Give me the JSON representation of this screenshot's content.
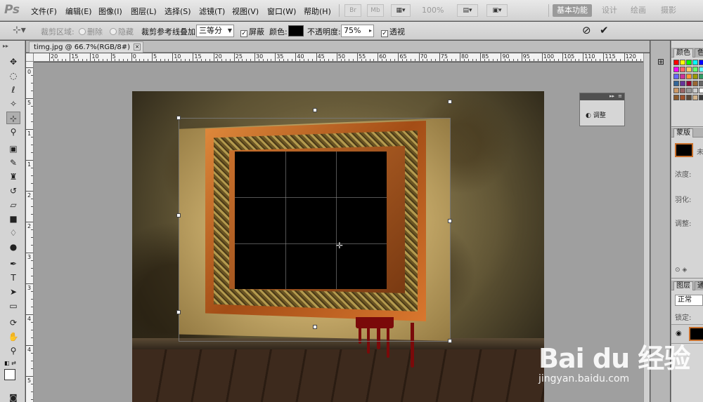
{
  "app": {
    "logo": "Ps",
    "menu": [
      "文件(F)",
      "编辑(E)",
      "图像(I)",
      "图层(L)",
      "选择(S)",
      "滤镜(T)",
      "视图(V)",
      "窗口(W)",
      "帮助(H)"
    ],
    "menubar_icons": [
      "Br",
      "Mb"
    ],
    "zoom": "100%",
    "workspaces": [
      "基本功能",
      "设计",
      "绘画",
      "摄影"
    ]
  },
  "options": {
    "crop_area_label": "裁剪区域:",
    "delete_label": "删除",
    "hide_label": "隐藏",
    "overlay_label": "裁剪参考线叠加:",
    "overlay_value": "三等分",
    "shield_label": "屏蔽",
    "shield_checked": true,
    "color_label": "颜色:",
    "shield_color": "#000000",
    "opacity_label": "不透明度:",
    "opacity_value": "75%",
    "perspective_label": "透视",
    "perspective_checked": true
  },
  "document": {
    "tab_title": "timg.jpg @ 66.7%(RGB/8#)",
    "ruler_top_labels": [
      "20",
      "15",
      "10",
      "5",
      "0",
      "5",
      "10",
      "15",
      "20",
      "25",
      "30",
      "35",
      "40",
      "45",
      "50",
      "55",
      "60",
      "65",
      "70",
      "75",
      "80",
      "85",
      "90",
      "95",
      "100",
      "105",
      "110",
      "115",
      "120"
    ],
    "ruler_left_labels": [
      "0",
      "5",
      "1",
      "1",
      "2",
      "2",
      "3",
      "3",
      "4",
      "4",
      "5"
    ]
  },
  "float_panel": {
    "button_label": "调整"
  },
  "panels": {
    "color_tab": "颜色",
    "color_tab2": "色",
    "masks_tab": "蒙版",
    "mask_label": "未",
    "density_label": "浓度:",
    "feather_label": "羽化:",
    "adjust_label": "调整:",
    "layers_tab": "图层",
    "layers_tab2": "通",
    "blend_mode": "正常",
    "lock_label": "锁定:"
  },
  "watermark": {
    "main": "Bai du 经验",
    "sub": "jingyan.baidu.com"
  }
}
